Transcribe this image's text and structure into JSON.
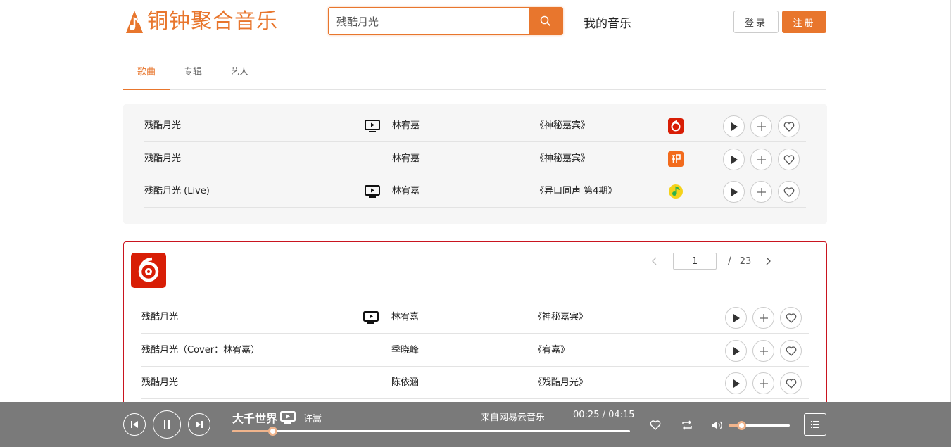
{
  "brand": {
    "name": "铜钟聚合音乐",
    "accent": "#e8762d"
  },
  "search": {
    "value": "残酷月光"
  },
  "nav": {
    "my_music": "我的音乐",
    "login": "登录",
    "register": "注册"
  },
  "tabs": [
    {
      "label": "歌曲",
      "active": true
    },
    {
      "label": "专辑",
      "active": false
    },
    {
      "label": "艺人",
      "active": false
    }
  ],
  "top_results": [
    {
      "title": "残酷月光",
      "has_mv": true,
      "artist": "林宥嘉",
      "album": "《神秘嘉宾》",
      "source_icon": "netease-icon"
    },
    {
      "title": "残酷月光",
      "has_mv": false,
      "artist": "林宥嘉",
      "album": "《神秘嘉宾》",
      "source_icon": "xiami-icon"
    },
    {
      "title": "残酷月光 (Live)",
      "has_mv": true,
      "artist": "林宥嘉",
      "album": "《异口同声 第4期》",
      "source_icon": "qq-music-icon"
    }
  ],
  "netease_panel": {
    "source_icon": "netease-icon",
    "pager": {
      "current": "1",
      "separator": "/",
      "total": "23"
    },
    "songs": [
      {
        "title": "残酷月光",
        "has_mv": true,
        "artist": "林宥嘉",
        "album": "《神秘嘉宾》"
      },
      {
        "title": "残酷月光（Cover：林宥嘉）",
        "has_mv": false,
        "artist": "季晓峰",
        "album": "《宥嘉》"
      },
      {
        "title": "残酷月光",
        "has_mv": false,
        "artist": "陈依涵",
        "album": "《残酷月光》"
      }
    ]
  },
  "player": {
    "title": "大千世界",
    "artist": "许嵩",
    "source": "来自网易云音乐",
    "time": "00:25 / 04:15",
    "progress": 0.1,
    "volume": 0.2
  }
}
